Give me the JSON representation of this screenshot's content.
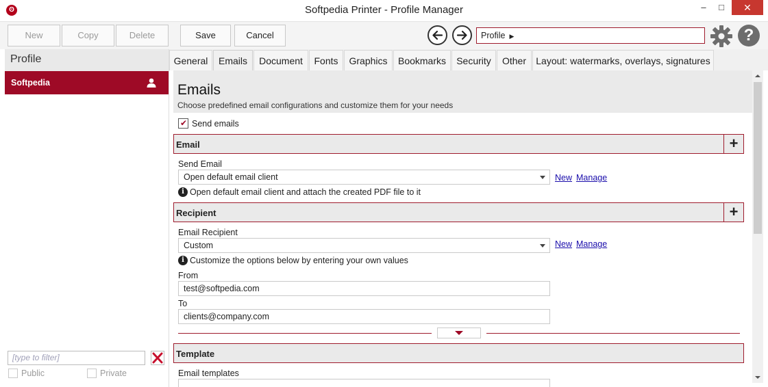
{
  "window": {
    "title": "Softpedia Printer - Profile Manager",
    "app_icon": "softpedia-printer-logo"
  },
  "toolbar": {
    "new_label": "New",
    "copy_label": "Copy",
    "delete_label": "Delete",
    "save_label": "Save",
    "cancel_label": "Cancel",
    "profile_path": "Profile"
  },
  "sidebar": {
    "header": "Profile",
    "profiles": [
      {
        "name": "Softpedia"
      }
    ],
    "filter_placeholder": "[type to filter]",
    "public_label": "Public",
    "private_label": "Private"
  },
  "tabs": [
    {
      "label": "General"
    },
    {
      "label": "Emails",
      "active": true
    },
    {
      "label": "Document"
    },
    {
      "label": "Fonts"
    },
    {
      "label": "Graphics"
    },
    {
      "label": "Bookmarks"
    },
    {
      "label": "Security"
    },
    {
      "label": "Other"
    },
    {
      "label": "Layout: watermarks, overlays, signatures"
    }
  ],
  "main": {
    "title": "Emails",
    "subtitle": "Choose predefined email configurations and customize them for your needs",
    "send_emails_label": "Send emails",
    "send_emails_checked": true,
    "email_section": {
      "title": "Email",
      "field_label": "Send Email",
      "selected": "Open default email client",
      "new_link": "New",
      "manage_link": "Manage",
      "info": "Open default email client and attach the created PDF file to it"
    },
    "recipient_section": {
      "title": "Recipient",
      "field_label": "Email Recipient",
      "selected": "Custom",
      "new_link": "New",
      "manage_link": "Manage",
      "info": "Customize the options below by entering your own values",
      "from_label": "From",
      "from_value": "test@softpedia.com",
      "to_label": "To",
      "to_value": "clients@company.com"
    },
    "template_section": {
      "title": "Template",
      "field_label": "Email templates"
    }
  },
  "colors": {
    "accent": "#9e0a26",
    "close_button": "#c7372f"
  }
}
